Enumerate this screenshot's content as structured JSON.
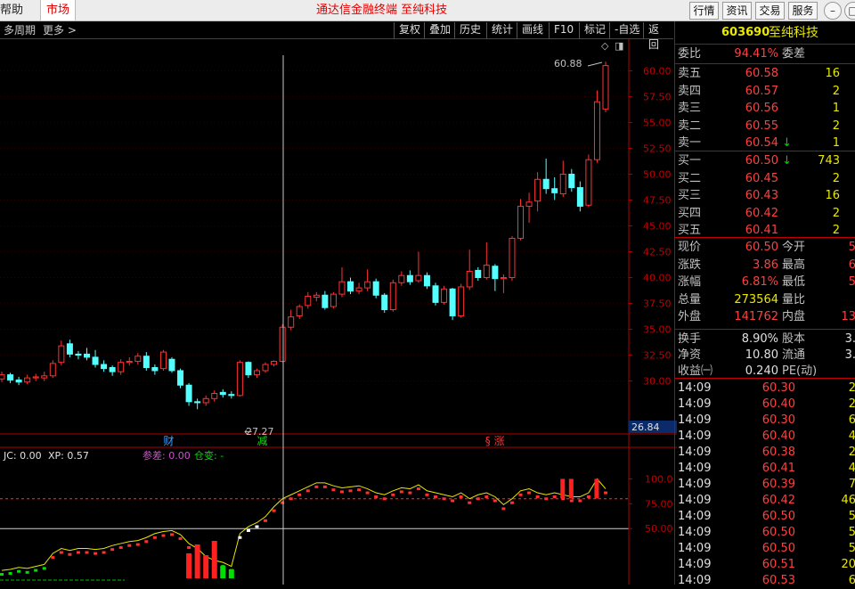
{
  "topbar": {
    "help": "帮助",
    "market": "市场",
    "title": "通达信金融终端  至纯科技",
    "buttons": [
      "行情",
      "资讯",
      "交易",
      "服务"
    ]
  },
  "toolbar": {
    "left": [
      "多周期",
      "更多 >"
    ],
    "tools": [
      "复权",
      "叠加",
      "历史",
      "统计",
      "画线",
      "F10",
      "标记",
      "-自选",
      "返回"
    ]
  },
  "chart_data": {
    "type": "candlestick",
    "price_axis": {
      "ticks": [
        60.0,
        57.5,
        55.0,
        52.5,
        50.0,
        47.5,
        45.0,
        42.5,
        40.0,
        37.5,
        35.0,
        32.5,
        30.0
      ],
      "labels": [
        "60.00",
        "57.50",
        "55.00",
        "52.50",
        "50.00",
        "47.50",
        "45.00",
        "42.50",
        "40.00",
        "37.50",
        "35.00",
        "32.50",
        "30.00"
      ],
      "range": [
        26.0,
        61.5
      ]
    },
    "high_label": "60.88",
    "low_label": "27.27",
    "cursor_price": "26.84",
    "markers": [
      {
        "text": "财",
        "color": "#3b9dff",
        "bar": 19
      },
      {
        "text": "减",
        "color": "#00e000",
        "bar": 30
      },
      {
        "text": "§ 涨",
        "color": "#ff3030",
        "bar": 56
      }
    ],
    "candles": [
      [
        30.2,
        30.6,
        30.9,
        29.9
      ],
      [
        30.6,
        30.1,
        30.8,
        29.8
      ],
      [
        30.1,
        29.9,
        30.4,
        29.6
      ],
      [
        29.9,
        30.3,
        30.6,
        29.7
      ],
      [
        30.3,
        30.4,
        30.7,
        30.0
      ],
      [
        30.3,
        30.5,
        30.9,
        30.0
      ],
      [
        30.5,
        31.7,
        32.0,
        30.3
      ],
      [
        31.8,
        33.4,
        33.9,
        31.5
      ],
      [
        33.6,
        32.6,
        34.0,
        32.3
      ],
      [
        32.6,
        32.5,
        32.9,
        32.1
      ],
      [
        32.6,
        32.3,
        33.2,
        32.0
      ],
      [
        32.3,
        31.6,
        33.0,
        31.3
      ],
      [
        31.6,
        31.2,
        32.0,
        30.9
      ],
      [
        31.3,
        30.9,
        31.5,
        30.5
      ],
      [
        30.9,
        31.8,
        32.1,
        30.6
      ],
      [
        31.8,
        31.9,
        32.3,
        31.5
      ],
      [
        31.9,
        32.4,
        32.7,
        31.6
      ],
      [
        32.4,
        31.3,
        32.8,
        31.0
      ],
      [
        31.3,
        31.0,
        31.6,
        30.6
      ],
      [
        31.2,
        32.8,
        33.0,
        31.0
      ],
      [
        32.1,
        31.0,
        32.3,
        30.8
      ],
      [
        31.0,
        29.6,
        31.2,
        29.3
      ],
      [
        29.6,
        28.0,
        29.8,
        27.6
      ],
      [
        28.0,
        27.9,
        28.3,
        27.27
      ],
      [
        27.9,
        28.3,
        28.6,
        27.6
      ],
      [
        28.3,
        28.8,
        29.1,
        28.0
      ],
      [
        28.9,
        28.7,
        29.2,
        28.4
      ],
      [
        28.7,
        28.6,
        29.0,
        28.3
      ],
      [
        28.6,
        31.8,
        32.0,
        28.5
      ],
      [
        31.8,
        30.6,
        31.9,
        30.3
      ],
      [
        30.6,
        31.0,
        31.2,
        30.3
      ],
      [
        31.0,
        31.6,
        31.8,
        30.8
      ],
      [
        31.6,
        31.9,
        32.0,
        31.4
      ],
      [
        31.9,
        35.2,
        35.5,
        31.8
      ],
      [
        35.2,
        36.2,
        36.9,
        34.9
      ],
      [
        36.3,
        37.2,
        37.4,
        36.0
      ],
      [
        37.3,
        38.2,
        38.6,
        37.0
      ],
      [
        38.1,
        38.3,
        38.6,
        37.7
      ],
      [
        38.3,
        37.1,
        38.7,
        36.9
      ],
      [
        37.2,
        38.4,
        38.6,
        37.0
      ],
      [
        38.4,
        39.6,
        41.0,
        38.1
      ],
      [
        39.6,
        38.7,
        40.0,
        38.4
      ],
      [
        38.7,
        39.0,
        39.5,
        38.4
      ],
      [
        39.0,
        39.6,
        40.8,
        38.7
      ],
      [
        39.6,
        38.3,
        39.9,
        38.0
      ],
      [
        38.3,
        36.9,
        38.5,
        36.6
      ],
      [
        36.9,
        39.5,
        39.8,
        36.7
      ],
      [
        39.5,
        40.2,
        40.6,
        39.2
      ],
      [
        40.2,
        39.6,
        40.7,
        39.3
      ],
      [
        39.7,
        40.2,
        42.5,
        39.5
      ],
      [
        40.2,
        39.2,
        40.5,
        38.9
      ],
      [
        39.2,
        37.6,
        39.5,
        37.3
      ],
      [
        37.6,
        38.9,
        39.2,
        37.4
      ],
      [
        38.9,
        36.3,
        39.0,
        35.9
      ],
      [
        36.3,
        39.1,
        39.4,
        36.1
      ],
      [
        39.1,
        40.6,
        42.7,
        38.8
      ],
      [
        40.7,
        40.0,
        41.0,
        39.7
      ],
      [
        40.0,
        41.2,
        43.4,
        39.8
      ],
      [
        41.1,
        39.9,
        41.3,
        38.7
      ],
      [
        39.9,
        40.0,
        40.3,
        38.5
      ],
      [
        40.0,
        43.8,
        44.0,
        39.7
      ],
      [
        43.8,
        46.9,
        47.6,
        43.6
      ],
      [
        46.9,
        47.3,
        48.2,
        45.3
      ],
      [
        47.4,
        49.5,
        50.2,
        46.4
      ],
      [
        49.5,
        48.6,
        51.5,
        48.1
      ],
      [
        48.6,
        48.2,
        49.7,
        47.5
      ],
      [
        48.1,
        50.0,
        51.3,
        47.8
      ],
      [
        50.0,
        48.7,
        50.5,
        48.3
      ],
      [
        48.7,
        46.9,
        49.3,
        46.4
      ],
      [
        47.0,
        51.4,
        51.9,
        46.8
      ],
      [
        51.4,
        57.0,
        58.1,
        51.1
      ],
      [
        56.3,
        60.5,
        60.88,
        56.0
      ]
    ],
    "indicator": {
      "jc": "JC: 0.00",
      "xp": "XP: 0.57",
      "cancha": "参差: 0.00",
      "cangbian": "仓变: -",
      "ticks": [
        "100.0",
        "75.00",
        "50.00"
      ],
      "tick_values": [
        100,
        75,
        50
      ],
      "range": [
        0,
        112
      ]
    },
    "indicator_line": [
      8,
      9,
      11,
      10,
      12,
      14,
      25,
      30,
      28,
      30,
      30,
      29,
      30,
      33,
      35,
      37,
      38,
      41,
      45,
      47,
      48,
      44,
      35,
      30,
      22,
      18,
      16,
      12,
      45,
      52,
      56,
      62,
      72,
      80,
      84,
      88,
      92,
      96,
      96,
      93,
      91,
      92,
      93,
      90,
      86,
      84,
      88,
      91,
      90,
      94,
      88,
      86,
      84,
      82,
      86,
      80,
      84,
      86,
      82,
      74,
      80,
      88,
      90,
      86,
      84,
      86,
      84,
      82,
      82,
      86,
      100,
      90
    ]
  },
  "quote": {
    "code": "603690",
    "name": "至纯科技",
    "wb_label": "委比",
    "wb_value": "94.41%",
    "wc_label": "委差",
    "sells": [
      {
        "label": "卖五",
        "price": "60.58",
        "vol": "16",
        "arrow": ""
      },
      {
        "label": "卖四",
        "price": "60.57",
        "vol": "2",
        "arrow": ""
      },
      {
        "label": "卖三",
        "price": "60.56",
        "vol": "1",
        "arrow": ""
      },
      {
        "label": "卖二",
        "price": "60.55",
        "vol": "2",
        "arrow": ""
      },
      {
        "label": "卖一",
        "price": "60.54",
        "vol": "1",
        "arrow": "↓"
      }
    ],
    "buys": [
      {
        "label": "买一",
        "price": "60.50",
        "vol": "743",
        "arrow": "↓"
      },
      {
        "label": "买二",
        "price": "60.45",
        "vol": "2",
        "arrow": ""
      },
      {
        "label": "买三",
        "price": "60.43",
        "vol": "16",
        "arrow": ""
      },
      {
        "label": "买四",
        "price": "60.42",
        "vol": "2",
        "arrow": ""
      },
      {
        "label": "买五",
        "price": "60.41",
        "vol": "2",
        "arrow": ""
      }
    ],
    "stats": [
      {
        "l1": "现价",
        "v1": "60.50",
        "c1": "red",
        "l2": "今开",
        "v2": "5"
      },
      {
        "l1": "涨跌",
        "v1": "3.86",
        "c1": "red",
        "l2": "最高",
        "v2": "6"
      },
      {
        "l1": "涨幅",
        "v1": "6.81%",
        "c1": "red",
        "l2": "最低",
        "v2": "5"
      },
      {
        "l1": "总量",
        "v1": "273564",
        "c1": "yel",
        "l2": "量比",
        "v2": ""
      },
      {
        "l1": "外盘",
        "v1": "141762",
        "c1": "red",
        "l2": "内盘",
        "v2": "13"
      }
    ],
    "stats2": [
      {
        "l1": "换手",
        "v1": "8.90%",
        "l2": "股本",
        "v2": "3."
      },
      {
        "l1": "净资",
        "v1": "10.80",
        "l2": "流通",
        "v2": "3."
      },
      {
        "l1": "收益㈠",
        "v1": "0.240",
        "l2": "PE(动)",
        "v2": ""
      }
    ],
    "ticks": [
      {
        "t": "14:09",
        "p": "60.30",
        "v": "2",
        "c": "red"
      },
      {
        "t": "14:09",
        "p": "60.40",
        "v": "2",
        "c": "red"
      },
      {
        "t": "14:09",
        "p": "60.30",
        "v": "6",
        "c": "red"
      },
      {
        "t": "14:09",
        "p": "60.40",
        "v": "4",
        "c": "red"
      },
      {
        "t": "14:09",
        "p": "60.38",
        "v": "2",
        "c": "red"
      },
      {
        "t": "14:09",
        "p": "60.41",
        "v": "4",
        "c": "red"
      },
      {
        "t": "14:09",
        "p": "60.39",
        "v": "7",
        "c": "red"
      },
      {
        "t": "14:09",
        "p": "60.42",
        "v": "46",
        "c": "red"
      },
      {
        "t": "14:09",
        "p": "60.50",
        "v": "5",
        "c": "red"
      },
      {
        "t": "14:09",
        "p": "60.50",
        "v": "5",
        "c": "red"
      },
      {
        "t": "14:09",
        "p": "60.50",
        "v": "5",
        "c": "red"
      },
      {
        "t": "14:09",
        "p": "60.51",
        "v": "20",
        "c": "red"
      },
      {
        "t": "14:09",
        "p": "60.53",
        "v": "6",
        "c": "red"
      }
    ]
  },
  "colors": {
    "up": "#ff3232",
    "down": "#54ffff",
    "axis": "#b00000",
    "accent_red": "#ff4040",
    "yellow": "#e8e800"
  }
}
